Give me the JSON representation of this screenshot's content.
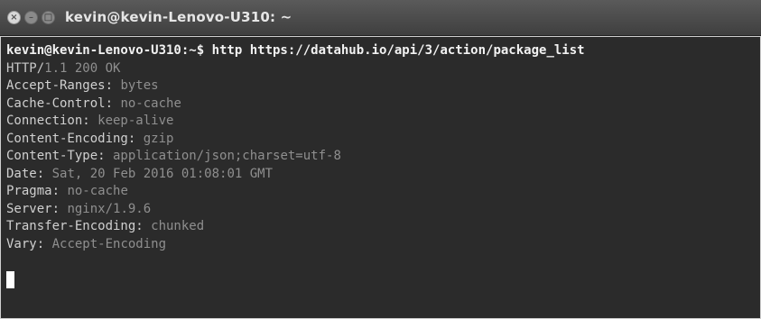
{
  "window": {
    "title": "kevin@kevin-Lenovo-U310: ~",
    "buttons": {
      "close": "×",
      "minimize": "–",
      "maximize": "□"
    }
  },
  "terminal": {
    "prompt": "kevin@kevin-Lenovo-U310:~$ ",
    "command": "http https://datahub.io/api/3/action/package_list",
    "status_line": {
      "protocol": "HTTP/",
      "rest": "1.1 200 OK"
    },
    "headers": [
      {
        "key": "Accept-Ranges:",
        "value": " bytes"
      },
      {
        "key": "Cache-Control:",
        "value": " no-cache"
      },
      {
        "key": "Connection:",
        "value": " keep-alive"
      },
      {
        "key": "Content-Encoding:",
        "value": " gzip"
      },
      {
        "key": "Content-Type:",
        "value": " application/json;charset=utf-8"
      },
      {
        "key": "Date:",
        "value": " Sat, 20 Feb 2016 01:08:01 GMT"
      },
      {
        "key": "Pragma:",
        "value": " no-cache"
      },
      {
        "key": "Server:",
        "value": " nginx/1.9.6"
      },
      {
        "key": "Transfer-Encoding:",
        "value": " chunked"
      },
      {
        "key": "Vary:",
        "value": " Accept-Encoding"
      }
    ]
  },
  "colors": {
    "terminal_bg": "#2b2b2b",
    "titlebar_bg": "#4a4a4a",
    "text_bright": "#f2f2f2",
    "text_dim": "#8f8f8f"
  }
}
